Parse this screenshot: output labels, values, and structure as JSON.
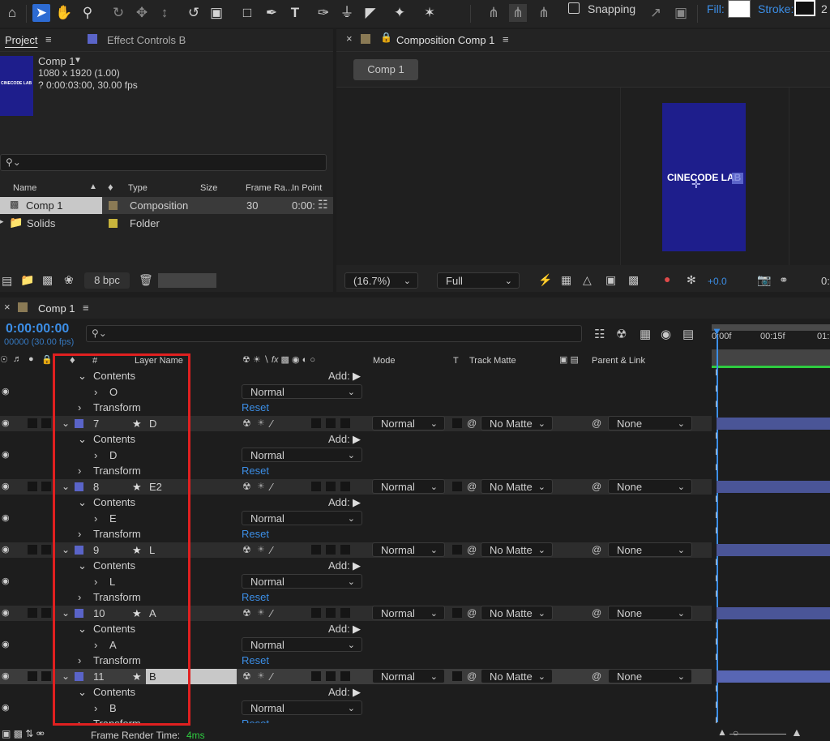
{
  "toolbar": {
    "tools": [
      "home-icon",
      "selection-tool-icon",
      "hand-tool-icon",
      "zoom-tool-icon",
      "orbit-camera-icon",
      "pan-camera-icon",
      "dolly-camera-icon",
      "rotate-tool-icon",
      "anchor-tool-icon",
      "rectangle-tool-icon",
      "pen-tool-icon",
      "type-tool-icon",
      "brush-tool-icon",
      "clone-stamp-icon",
      "eraser-tool-icon",
      "roto-brush-icon",
      "puppet-pin-icon"
    ],
    "snapping_label": "Snapping",
    "fill_label": "Fill:",
    "stroke_label": "Stroke:",
    "stroke_value": "2"
  },
  "project_panel": {
    "tab_label": "Project",
    "effect_controls_label": "Effect Controls B",
    "thumb_text": "CINECODE LAB",
    "comp_name": "Comp 1",
    "comp_size": "1080 x 1920 (1.00)",
    "comp_duration": "? 0:00:03:00, 30.00 fps",
    "search_placeholder": "",
    "columns": [
      "Name",
      "Type",
      "Size",
      "Frame Ra...",
      "In Point"
    ],
    "items": [
      {
        "name": "Comp 1",
        "type": "Composition",
        "frame_rate": "30",
        "in_point": "0:00:",
        "label_color": "#8a7a55"
      },
      {
        "name": "Solids",
        "type": "Folder",
        "frame_rate": "",
        "in_point": "",
        "label_color": "#c8b43c"
      }
    ],
    "bpc_label": "8 bpc"
  },
  "comp_panel": {
    "tab_label": "Composition Comp 1",
    "crumb": "Comp 1",
    "viewer_text": "CINECODE LAB",
    "zoom": "(16.7%)",
    "resolution": "Full",
    "exposure": "+0.0",
    "trailing": "0:"
  },
  "timeline": {
    "tab_label": "Comp 1",
    "timecode": "0:00:00:00",
    "frames": "00000 (30.00 fps)",
    "columns": {
      "hash": "#",
      "layer_name": "Layer Name",
      "mode": "Mode",
      "t": "T",
      "track_matte": "Track Matte",
      "parent": "Parent & Link"
    },
    "ruler": [
      "0:00f",
      "00:15f",
      "01:"
    ],
    "rows": [
      {
        "kind": "sub",
        "indent": 1,
        "label": "Contents",
        "right": "Add:"
      },
      {
        "kind": "sub",
        "indent": 2,
        "label": "O",
        "mode": "Normal"
      },
      {
        "kind": "sub",
        "indent": 1,
        "label": "Transform",
        "reset": "Reset"
      },
      {
        "kind": "layer",
        "num": "7",
        "name": "D",
        "mode": "Normal",
        "matte": "No Matte",
        "parent": "None"
      },
      {
        "kind": "sub",
        "indent": 1,
        "label": "Contents",
        "right": "Add:"
      },
      {
        "kind": "sub",
        "indent": 2,
        "label": "D",
        "mode": "Normal"
      },
      {
        "kind": "sub",
        "indent": 1,
        "label": "Transform",
        "reset": "Reset"
      },
      {
        "kind": "layer",
        "num": "8",
        "name": "E2",
        "mode": "Normal",
        "matte": "No Matte",
        "parent": "None"
      },
      {
        "kind": "sub",
        "indent": 1,
        "label": "Contents",
        "right": "Add:"
      },
      {
        "kind": "sub",
        "indent": 2,
        "label": "E",
        "mode": "Normal"
      },
      {
        "kind": "sub",
        "indent": 1,
        "label": "Transform",
        "reset": "Reset"
      },
      {
        "kind": "layer",
        "num": "9",
        "name": "L",
        "mode": "Normal",
        "matte": "No Matte",
        "parent": "None"
      },
      {
        "kind": "sub",
        "indent": 1,
        "label": "Contents",
        "right": "Add:"
      },
      {
        "kind": "sub",
        "indent": 2,
        "label": "L",
        "mode": "Normal"
      },
      {
        "kind": "sub",
        "indent": 1,
        "label": "Transform",
        "reset": "Reset"
      },
      {
        "kind": "layer",
        "num": "10",
        "name": "A",
        "mode": "Normal",
        "matte": "No Matte",
        "parent": "None"
      },
      {
        "kind": "sub",
        "indent": 1,
        "label": "Contents",
        "right": "Add:"
      },
      {
        "kind": "sub",
        "indent": 2,
        "label": "A",
        "mode": "Normal"
      },
      {
        "kind": "sub",
        "indent": 1,
        "label": "Transform",
        "reset": "Reset"
      },
      {
        "kind": "layer",
        "num": "11",
        "name": "B",
        "mode": "Normal",
        "matte": "No Matte",
        "parent": "None",
        "selected": true
      },
      {
        "kind": "sub",
        "indent": 1,
        "label": "Contents",
        "right": "Add:"
      },
      {
        "kind": "sub",
        "indent": 2,
        "label": "B",
        "mode": "Normal"
      },
      {
        "kind": "sub",
        "indent": 1,
        "label": "Transform",
        "reset": "Reset"
      }
    ],
    "status_label": "Frame Render Time:",
    "status_value": "4ms"
  },
  "colors": {
    "accent": "#2d6bd3",
    "label_blue": "#5a64c8",
    "highlight_red": "#e02020",
    "timeline_green": "#2ecc40",
    "comp_bg": "#1e1e8c"
  }
}
